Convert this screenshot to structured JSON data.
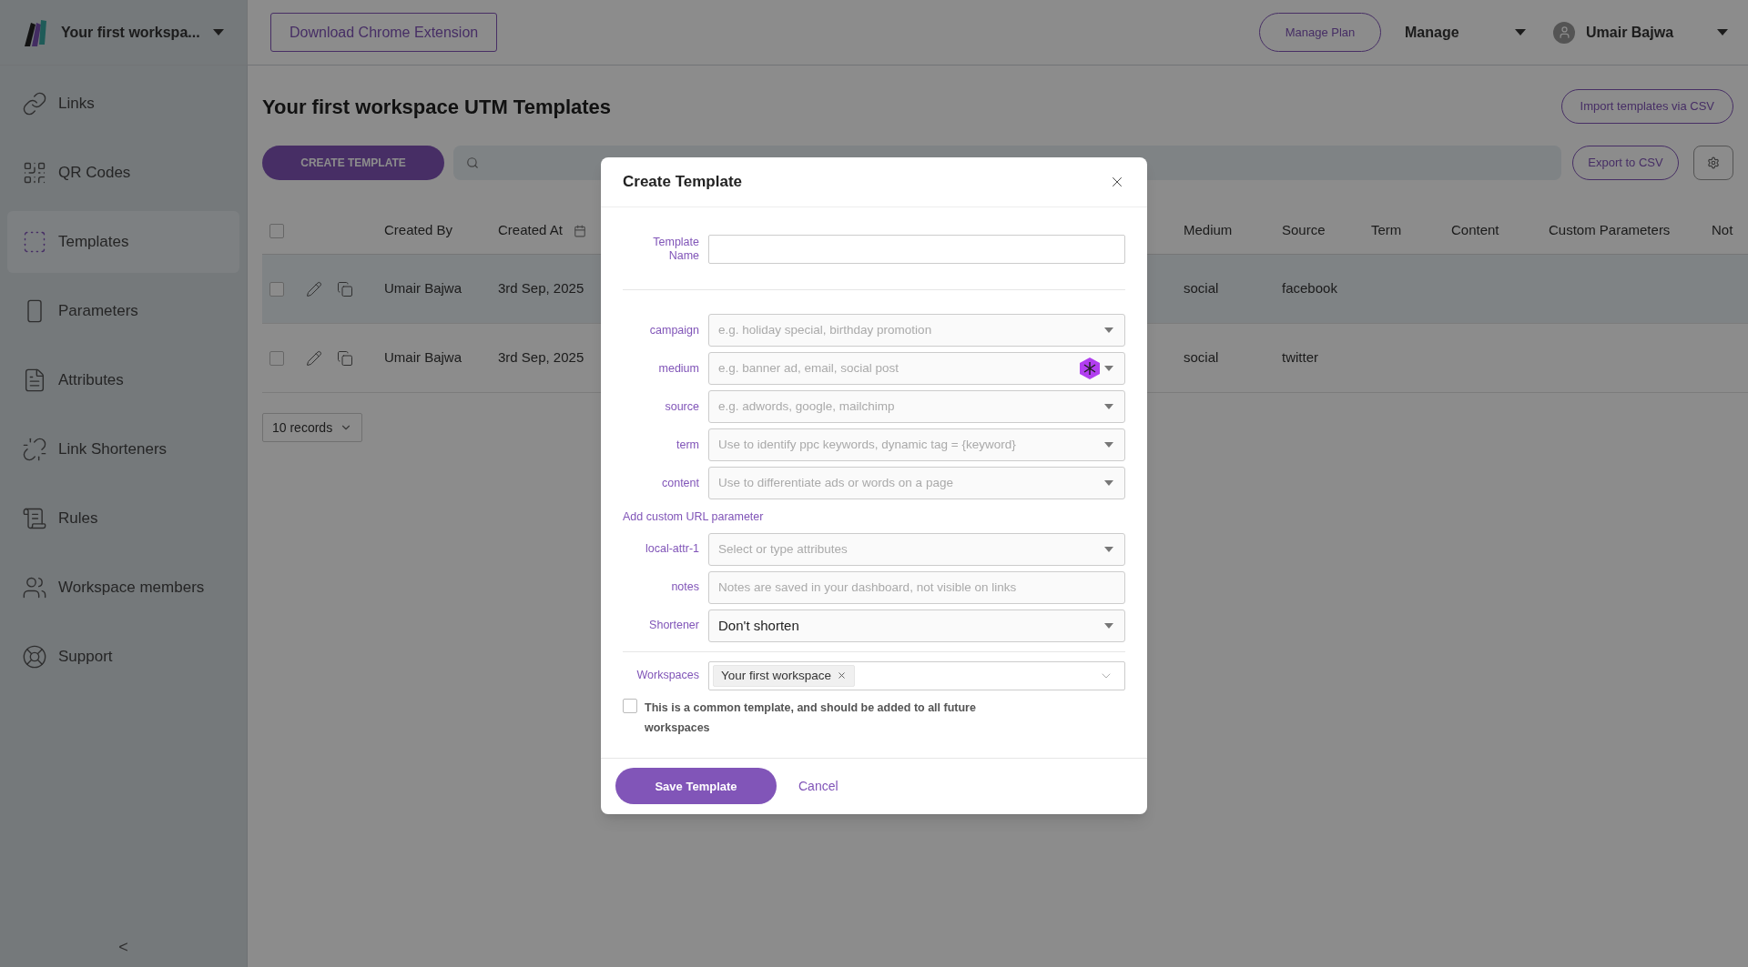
{
  "topbar": {
    "workspace_name": "Your first workspa...",
    "extension_button": "Download Chrome Extension",
    "plan_button": "Manage Plan",
    "manage_menu": "Manage",
    "user_name": "Umair Bajwa"
  },
  "sidebar": {
    "items": [
      {
        "label": "Links",
        "selected": false
      },
      {
        "label": "QR Codes",
        "selected": false
      },
      {
        "label": "Templates",
        "selected": true
      },
      {
        "label": "Parameters",
        "selected": false
      },
      {
        "label": "Attributes",
        "selected": false
      },
      {
        "label": "Link Shorteners",
        "selected": false
      },
      {
        "label": "Rules",
        "selected": false
      },
      {
        "label": "Workspace members",
        "selected": false
      },
      {
        "label": "Support",
        "selected": false
      }
    ],
    "collapse": "<"
  },
  "page": {
    "title": "Your first workspace UTM Templates",
    "import_button": "Import templates via CSV",
    "create_button": "CREATE TEMPLATE",
    "export_button": "Export to CSV",
    "records_select": "10 records"
  },
  "table": {
    "all_checked": false,
    "columns": [
      "Created By",
      "Created At",
      "Medium",
      "Source",
      "Term",
      "Content",
      "Custom Parameters",
      "Not"
    ],
    "rows": [
      {
        "selected": true,
        "checked": false,
        "created_by": "Umair Bajwa",
        "created_at": "3rd Sep, 2025",
        "medium": "social",
        "source": "facebook"
      },
      {
        "selected": false,
        "checked": false,
        "created_by": "Umair Bajwa",
        "created_at": "3rd Sep, 2025",
        "medium": "social",
        "source": "twitter"
      }
    ]
  },
  "dialog": {
    "title": "Create Template",
    "name_label": "Template Name",
    "utm_fields": [
      {
        "label": "campaign",
        "placeholder": "e.g. holiday special, birthday promotion",
        "badge": false
      },
      {
        "label": "medium",
        "placeholder": "e.g. banner ad, email, social post",
        "badge": true
      },
      {
        "label": "source",
        "placeholder": "e.g. adwords, google, mailchimp",
        "badge": false
      },
      {
        "label": "term",
        "placeholder": "Use to identify ppc keywords, dynamic tag = {keyword}",
        "badge": false
      },
      {
        "label": "content",
        "placeholder": "Use to differentiate ads or words on a page",
        "badge": false
      }
    ],
    "custom_param_link": "Add custom URL parameter",
    "extra_fields": [
      {
        "kind": "select",
        "label": "local-attr-1",
        "placeholder": "Select or type attributes"
      },
      {
        "kind": "text",
        "label": "notes",
        "placeholder": "Notes are saved in your dashboard, not visible on links"
      },
      {
        "kind": "select",
        "label": "Shortener",
        "value": "Don't shorten"
      }
    ],
    "workspaces": {
      "label": "Workspaces",
      "tags": [
        "Your first workspace"
      ]
    },
    "common_template": {
      "label": "This is a common template, and should be added to all future workspaces",
      "checked": false
    },
    "save_button": "Save Template",
    "cancel_button": "Cancel"
  }
}
